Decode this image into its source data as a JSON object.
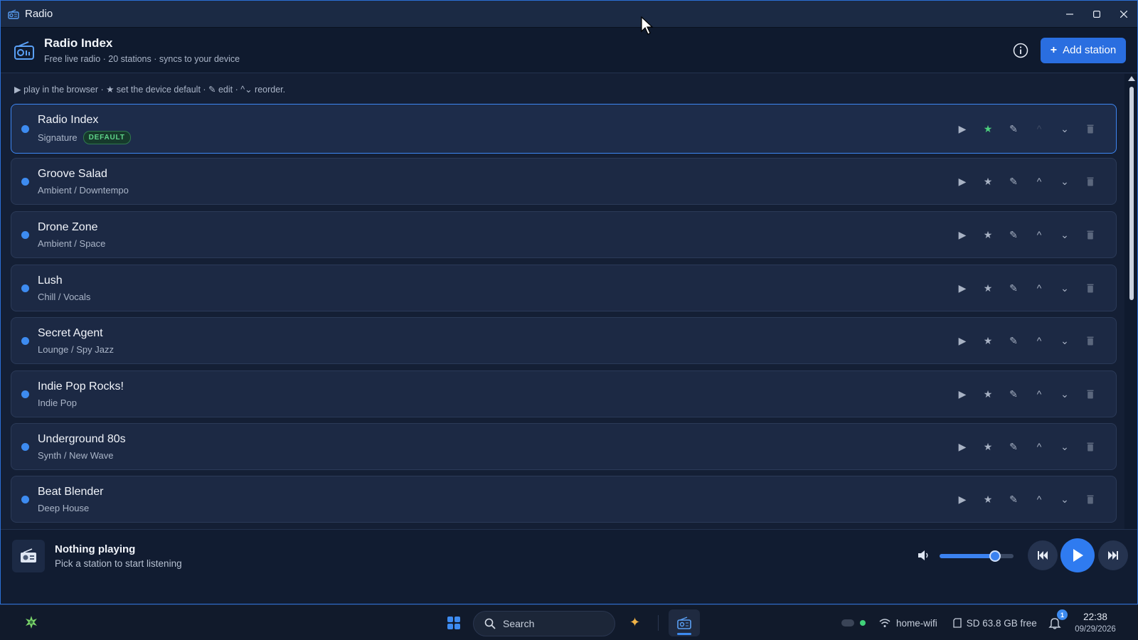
{
  "window": {
    "title": "Radio"
  },
  "header": {
    "title": "Radio Index",
    "subtitle": "Free live radio · 20 stations · syncs to your device",
    "add_label": "Add station",
    "add_plus": "+"
  },
  "hint": "▶ play in the browser · ★ set the device default · ✎ edit · ^⌄ reorder.",
  "stations": [
    {
      "name": "Radio Index",
      "genre": "Signature",
      "badge": "DEFAULT",
      "is_default": true
    },
    {
      "name": "Groove Salad",
      "genre": "Ambient / Downtempo"
    },
    {
      "name": "Drone Zone",
      "genre": "Ambient / Space"
    },
    {
      "name": "Lush",
      "genre": "Chill / Vocals"
    },
    {
      "name": "Secret Agent",
      "genre": "Lounge / Spy Jazz"
    },
    {
      "name": "Indie Pop Rocks!",
      "genre": "Indie Pop"
    },
    {
      "name": "Underground 80s",
      "genre": "Synth / New Wave"
    },
    {
      "name": "Beat Blender",
      "genre": "Deep House"
    }
  ],
  "row_actions": {
    "play": "▶",
    "star": "★",
    "edit": "✎",
    "up": "^",
    "down": "⌄"
  },
  "player": {
    "title": "Nothing playing",
    "subtitle": "Pick a station to start listening",
    "volume_percent": 75
  },
  "taskbar": {
    "search_placeholder": "Search",
    "wifi": "home-wifi",
    "storage": "SD 63.8 GB free",
    "notifications": "1",
    "time": "22:38",
    "date": "09/29/2026"
  },
  "colors": {
    "accent": "#2a6ee0",
    "default_badge": "#5fd48a",
    "station_dot": "#3d8bf0"
  }
}
